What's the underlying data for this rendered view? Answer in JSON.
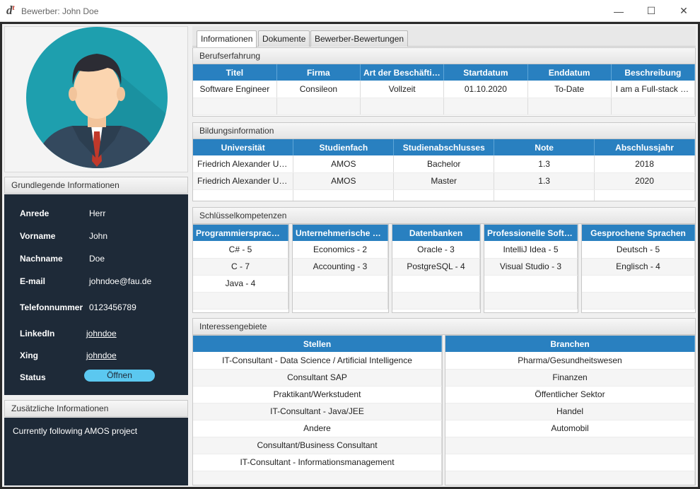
{
  "window": {
    "title": "Bewerber: John Doe",
    "app_icon_text": "d",
    "app_icon_accent": "t",
    "minimize": "—",
    "maximize": "☐",
    "close": "✕"
  },
  "left": {
    "basic_header": "Grundlegende Informationen",
    "fields": [
      {
        "label": "Anrede",
        "value": "Herr"
      },
      {
        "label": "Vorname",
        "value": "John"
      },
      {
        "label": "Nachname",
        "value": "Doe"
      },
      {
        "label": "E-mail",
        "value": "johndoe@fau.de"
      },
      {
        "label": "Telefonnummer",
        "value": "0123456789"
      },
      {
        "label": "LinkedIn",
        "value": "johndoe"
      },
      {
        "label": "Xing",
        "value": "johndoe"
      },
      {
        "label": "Status",
        "value": "Öffnen"
      }
    ],
    "extra_header": "Zusätzliche Informationen",
    "extra_text": "Currently following AMOS project"
  },
  "tabs": [
    {
      "label": "Informationen"
    },
    {
      "label": "Dokumente"
    },
    {
      "label": "Bewerber-Bewertungen"
    }
  ],
  "experience": {
    "header": "Berufserfahrung",
    "columns": [
      "Titel",
      "Firma",
      "Art der Beschäftigung",
      "Startdatum",
      "Enddatum",
      "Beschreibung"
    ],
    "rows": [
      [
        "Software Engineer",
        "Consileon",
        "Vollzeit",
        "01.10.2020",
        "To-Date",
        "I am a Full-stack engineer"
      ]
    ]
  },
  "education": {
    "header": "Bildungsinformation",
    "columns": [
      "Universität",
      "Studienfach",
      "Studienabschlusses",
      "Note",
      "Abschlussjahr"
    ],
    "rows": [
      [
        "Friedrich Alexander Universität",
        "AMOS",
        "Bachelor",
        "1.3",
        "2018"
      ],
      [
        "Friedrich Alexander Universität",
        "AMOS",
        "Master",
        "1.3",
        "2020"
      ]
    ]
  },
  "skills": {
    "header": "Schlüsselkompetenzen",
    "columns": [
      {
        "title": "Programmiersprachen",
        "items": [
          "C# - 5",
          "C - 7",
          "Java - 4"
        ]
      },
      {
        "title": "Unternehmerische Fähigkeiten",
        "items": [
          "Economics - 2",
          "Accounting - 3"
        ]
      },
      {
        "title": "Datenbanken",
        "items": [
          "Oracle - 3",
          "PostgreSQL - 4"
        ]
      },
      {
        "title": "Professionelle Software",
        "items": [
          "IntelliJ Idea - 5",
          "Visual Studio - 3"
        ]
      },
      {
        "title": "Gesprochene Sprachen",
        "items": [
          "Deutsch - 5",
          "Englisch - 4"
        ]
      }
    ]
  },
  "interests": {
    "header": "Interessengebiete",
    "positions_title": "Stellen",
    "positions": [
      "IT-Consultant - Data Science / Artificial Intelligence",
      "Consultant SAP",
      "Praktikant/Werkstudent",
      "IT-Consultant - Java/JEE",
      "Andere",
      "Consultant/Business Consultant",
      "IT-Consultant - Informationsmanagement"
    ],
    "industries_title": "Branchen",
    "industries": [
      "Pharma/Gesundheitswesen",
      "Finanzen",
      "Öffentlicher Sektor",
      "Handel",
      "Automobil"
    ]
  },
  "colors": {
    "header_blue": "#2980c0",
    "dark_panel": "#1e2a38",
    "badge": "#5bc8f0"
  }
}
